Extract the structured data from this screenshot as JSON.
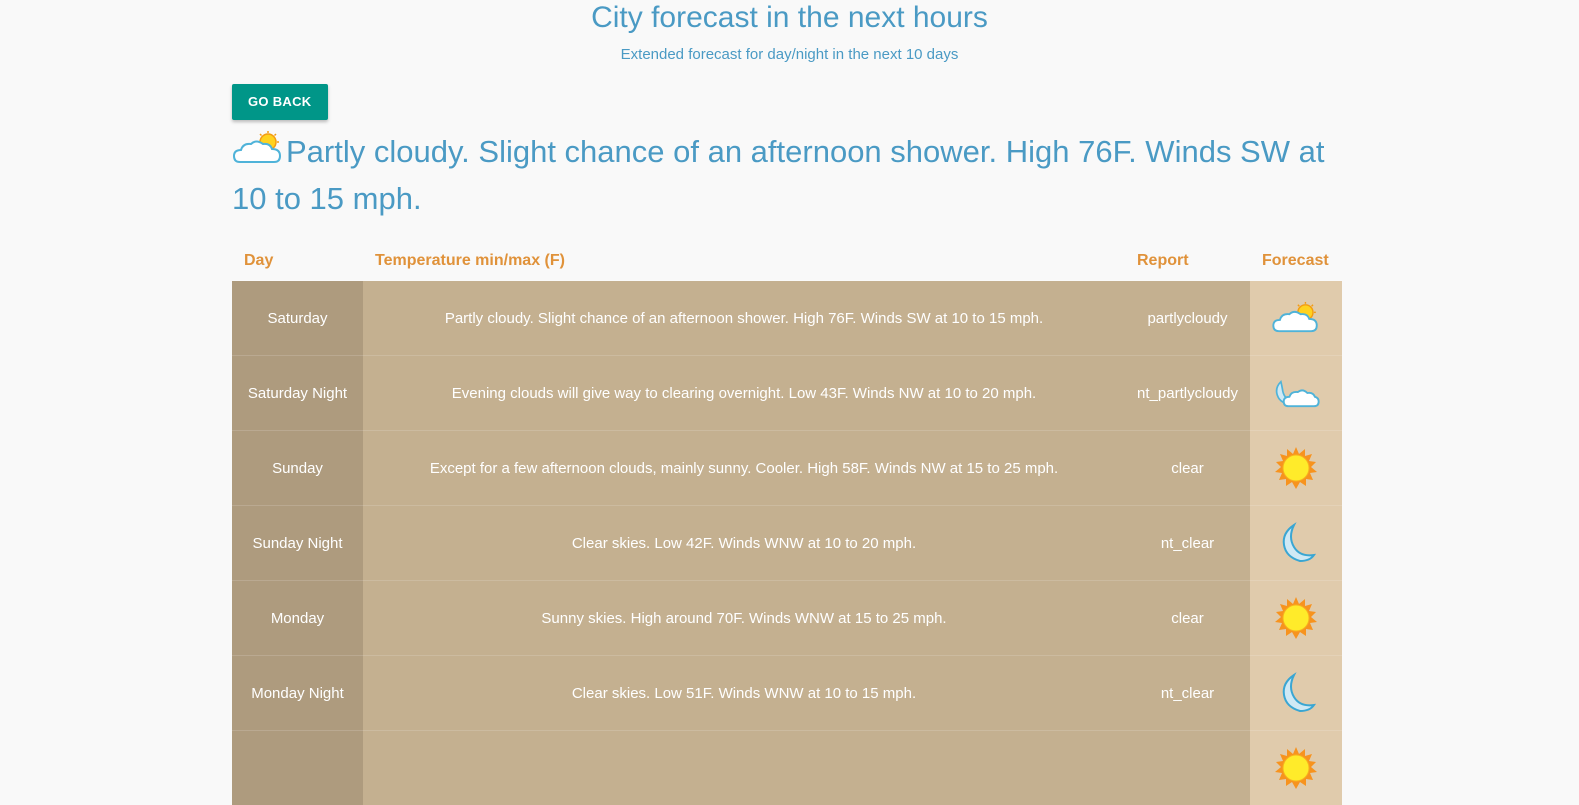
{
  "header": {
    "title": "City forecast in the next hours",
    "subtitle": "Extended forecast for day/night in the next 10 days"
  },
  "actions": {
    "go_back_label": "GO BACK"
  },
  "headline": {
    "icon": "partly-cloudy-icon",
    "text": "Partly cloudy. Slight chance of an afternoon shower. High 76F. Winds SW at 10 to 15 mph."
  },
  "table": {
    "columns": [
      "Day",
      "Temperature min/max (F)",
      "Report",
      "Forecast"
    ],
    "rows": [
      {
        "day": "Saturday",
        "text": "Partly cloudy. Slight chance of an afternoon shower. High 76F. Winds SW at 10 to 15 mph.",
        "report": "partlycloudy",
        "icon": "partly-cloudy-icon"
      },
      {
        "day": "Saturday Night",
        "text": "Evening clouds will give way to clearing overnight. Low 43F. Winds NW at 10 to 20 mph.",
        "report": "nt_partlycloudy",
        "icon": "night-partly-cloudy-icon"
      },
      {
        "day": "Sunday",
        "text": "Except for a few afternoon clouds, mainly sunny. Cooler. High 58F. Winds NW at 15 to 25 mph.",
        "report": "clear",
        "icon": "sun-icon"
      },
      {
        "day": "Sunday Night",
        "text": "Clear skies. Low 42F. Winds WNW at 10 to 20 mph.",
        "report": "nt_clear",
        "icon": "moon-icon"
      },
      {
        "day": "Monday",
        "text": "Sunny skies. High around 70F. Winds WNW at 15 to 25 mph.",
        "report": "clear",
        "icon": "sun-icon"
      },
      {
        "day": "Monday Night",
        "text": "Clear skies. Low 51F. Winds WNW at 10 to 15 mph.",
        "report": "nt_clear",
        "icon": "moon-icon"
      },
      {
        "day": "",
        "text": "",
        "report": "",
        "icon": "sun-icon"
      }
    ]
  },
  "colors": {
    "accent": "#4a9ac4",
    "button": "#009688",
    "header_text": "#e0923a",
    "day_col": "#ae9b7e",
    "body_col": "#c4b090",
    "forecast_col": "#e0cbac"
  }
}
